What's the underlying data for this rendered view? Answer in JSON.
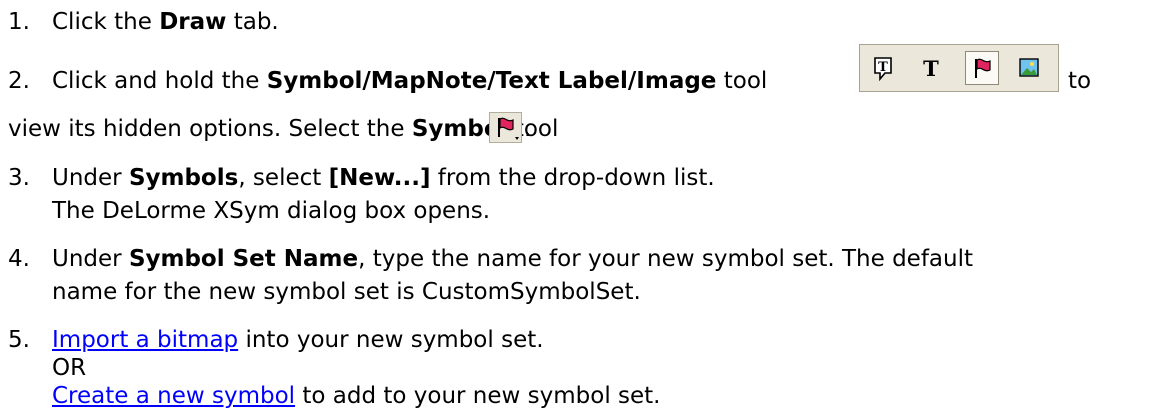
{
  "steps": [
    {
      "number": "1.",
      "text_before": "Click the ",
      "bold": "Draw",
      "text_after": " tab."
    },
    {
      "number": "2.",
      "line1_before": "Click and hold the ",
      "line1_bold": "Symbol/MapNote/Text Label/Image",
      "line1_after": " tool",
      "line1_tail": "to",
      "line2_before": "view its hidden options. Select the ",
      "line2_bold": "Symbol",
      "line2_after": " tool",
      "line2_end": "."
    },
    {
      "number": "3.",
      "line1_before": "Under ",
      "line1_bold": "Symbols",
      "line1_mid": ", select ",
      "line1_bold2": "[New...]",
      "line1_after": " from the drop-down list.",
      "line2": "The DeLorme XSym dialog box opens."
    },
    {
      "number": "4.",
      "line1_before": "Under ",
      "line1_bold": "Symbol Set Name",
      "line1_after": ", type the name for your new symbol set. The default",
      "line2": "name for the new symbol set is CustomSymbolSet."
    },
    {
      "number": "5.",
      "link1": "Import a bitmap",
      "line1_after": " into your new symbol set.",
      "or": "OR",
      "link2": "Create a new symbol",
      "line3_after": " to add to your new symbol set."
    }
  ],
  "toolbar": {
    "icons": [
      "mapnote-icon",
      "text-label-icon",
      "symbol-flag-icon",
      "image-icon"
    ],
    "active_icon": "symbol-flag-icon"
  },
  "colors": {
    "link": "#0000ff",
    "toolbar_bg": "#ebe7da",
    "flag": "#e0245e"
  }
}
